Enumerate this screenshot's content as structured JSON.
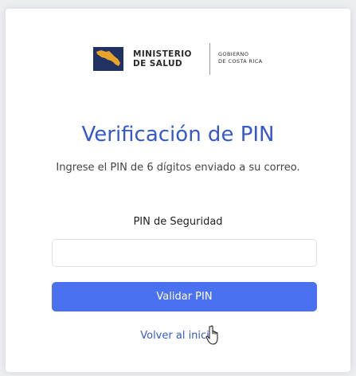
{
  "logo": {
    "ministerio_line1": "MINISTERIO",
    "ministerio_line2": "DE SALUD",
    "gobierno_line1": "GOBIERNO",
    "gobierno_line2": "DE COSTA RICA",
    "flag_color": "#1f3263",
    "map_color": "#e8a32a"
  },
  "form": {
    "title": "Verificación de PIN",
    "subtitle": "Ingrese el PIN de 6 dígitos enviado a su correo.",
    "pin_label": "PIN de Seguridad",
    "pin_value": "",
    "pin_placeholder": "",
    "submit_label": "Validar PIN",
    "back_link": "Volver al inicio"
  },
  "colors": {
    "accent": "#3558cf",
    "button": "#4a72f0",
    "background": "#eceef1"
  },
  "cursor_icon": "hand-pointer-icon"
}
